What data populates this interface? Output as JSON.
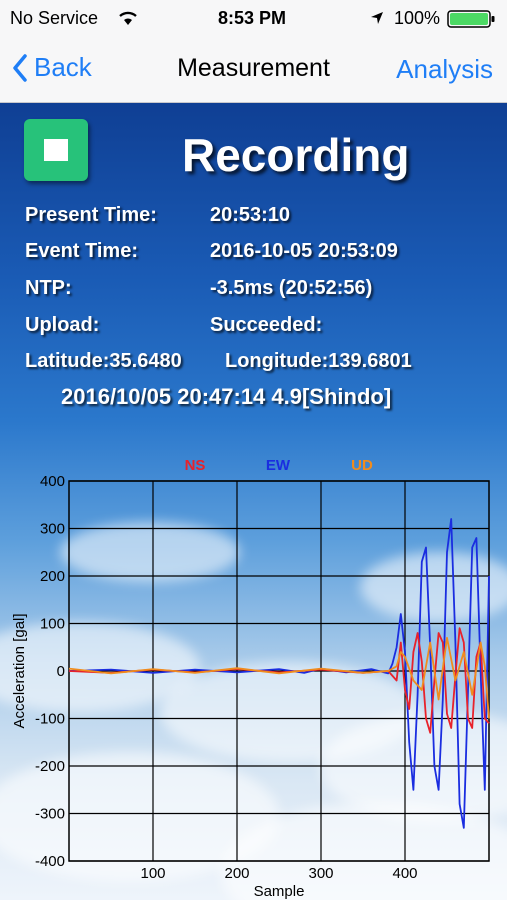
{
  "status_bar": {
    "carrier": "No Service",
    "time": "8:53 PM",
    "battery": "100%"
  },
  "nav": {
    "back_label": "Back",
    "title": "Measurement",
    "right_label": "Analysis"
  },
  "state": "Recording",
  "info": {
    "present_time_label": "Present Time:",
    "present_time": "20:53:10",
    "event_time_label": "Event Time:",
    "event_time": "2016-10-05 20:53:09",
    "ntp_label": "NTP:",
    "ntp": "-3.5ms (20:52:56)",
    "upload_label": "Upload:",
    "upload": "Succeeded:",
    "latitude": "Latitude:35.6480",
    "longitude": "Longitude:139.6801",
    "last_event": "2016/10/05 20:47:14 4.9[Shindo]"
  },
  "colors": {
    "ns": "#e8222b",
    "ew": "#1a2de0",
    "ud": "#f08c1e",
    "stop": "#27c27a"
  },
  "chart_data": {
    "type": "line",
    "xlabel": "Sample",
    "ylabel": "Acceleration [gal]",
    "xlim": [
      0,
      500
    ],
    "ylim": [
      -400,
      400
    ],
    "x_ticks": [
      100,
      200,
      300,
      400
    ],
    "y_ticks": [
      400,
      300,
      200,
      100,
      0,
      -100,
      -200,
      -300,
      -400
    ],
    "x_tick_labels": [
      "100",
      "200",
      "300",
      "400"
    ],
    "y_tick_labels": [
      "400",
      "300",
      "200",
      "100",
      "0",
      "-100",
      "-200",
      "-300",
      "-400"
    ],
    "series": [
      {
        "name": "EW",
        "color": "#1a2de0",
        "x": [
          0,
          50,
          100,
          150,
          200,
          250,
          280,
          300,
          330,
          360,
          380,
          385,
          390,
          395,
          400,
          405,
          410,
          415,
          420,
          425,
          430,
          435,
          440,
          445,
          450,
          455,
          460,
          465,
          470,
          475,
          480,
          485,
          490,
          495,
          500
        ],
        "values": [
          0,
          3,
          -4,
          3,
          -3,
          4,
          -4,
          5,
          -3,
          4,
          -5,
          15,
          50,
          120,
          40,
          -150,
          -250,
          -50,
          230,
          260,
          50,
          -200,
          -250,
          -60,
          250,
          320,
          60,
          -280,
          -330,
          -40,
          260,
          280,
          0,
          -250,
          200
        ]
      },
      {
        "name": "NS",
        "color": "#e8222b",
        "x": [
          0,
          50,
          100,
          150,
          200,
          250,
          300,
          350,
          380,
          390,
          395,
          400,
          405,
          410,
          415,
          420,
          425,
          430,
          435,
          440,
          445,
          450,
          455,
          460,
          465,
          470,
          475,
          480,
          485,
          490,
          495,
          500
        ],
        "values": [
          0,
          -4,
          3,
          -3,
          4,
          -3,
          3,
          -4,
          0,
          -20,
          60,
          -40,
          -80,
          40,
          80,
          20,
          -100,
          -130,
          -20,
          80,
          60,
          -90,
          -120,
          -10,
          90,
          60,
          -100,
          -120,
          30,
          60,
          -100,
          -110
        ]
      },
      {
        "name": "UD",
        "color": "#f08c1e",
        "x": [
          0,
          50,
          100,
          150,
          200,
          250,
          300,
          350,
          380,
          390,
          395,
          400,
          410,
          420,
          430,
          440,
          450,
          460,
          470,
          480,
          490,
          495,
          500
        ],
        "values": [
          5,
          -5,
          4,
          -4,
          6,
          -5,
          5,
          -4,
          0,
          10,
          40,
          30,
          -20,
          -40,
          60,
          -60,
          70,
          -20,
          40,
          -50,
          60,
          10,
          -100
        ]
      }
    ]
  }
}
